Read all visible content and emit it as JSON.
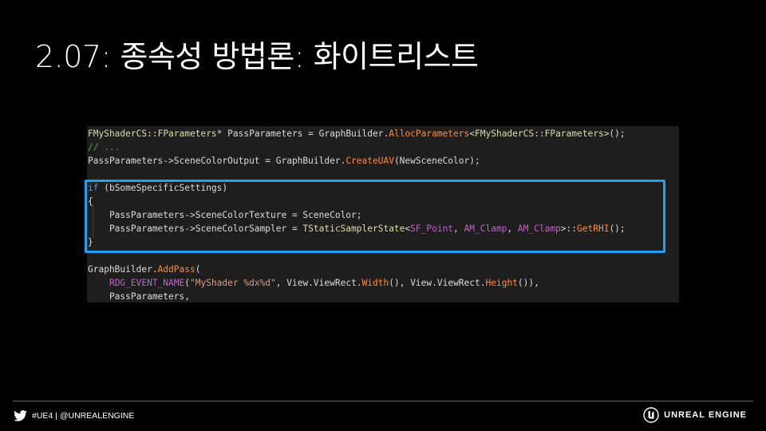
{
  "slide": {
    "title": "2.07: 종속성 방법론: 화이트리스트"
  },
  "code": {
    "line1": {
      "t1": "FMyShaderCS",
      "t2": "::",
      "t3": "FParameters",
      "t4": "* PassParameters = GraphBuilder.",
      "t5": "AllocParameters",
      "t6": "<",
      "t7": "FMyShaderCS",
      "t8": "::",
      "t9": "FParameters",
      "t10": ">();"
    },
    "line2": {
      "t1": "// ..."
    },
    "line3": {
      "t1": "PassParameters->SceneColorOutput = GraphBuilder.",
      "t2": "CreateUAV",
      "t3": "(NewSceneColor);"
    },
    "line4": {
      "t1": "if",
      "t2": " (bSomeSpecificSettings)"
    },
    "line5": {
      "t1": "{"
    },
    "line6": {
      "t1": "    PassParameters->SceneColorTexture = SceneColor;"
    },
    "line7": {
      "t1": "    PassParameters->SceneColorSampler = ",
      "t2": "TStaticSamplerState",
      "t3": "<",
      "t4": "SF_Point",
      "t5": ", ",
      "t6": "AM_Clamp",
      "t7": ", ",
      "t8": "AM_Clamp",
      "t9": ">::",
      "t10": "GetRHI",
      "t11": "();"
    },
    "line8": {
      "t1": "}"
    },
    "line9": {
      "t1": "GraphBuilder.",
      "t2": "AddPass",
      "t3": "("
    },
    "line10": {
      "t1": "    ",
      "t2": "RDG_EVENT_NAME",
      "t3": "(",
      "t4": "\"MyShader %dx%d\"",
      "t5": ", View.ViewRect.",
      "t6": "Width",
      "t7": "(), View.ViewRect.",
      "t8": "Height",
      "t9": "()),"
    },
    "line11": {
      "t1": "    PassParameters,"
    }
  },
  "footer": {
    "social_handle": "#UE4 | @UNREALENGINE",
    "brand": "UNREAL ENGINE",
    "icons": {
      "left": "twitter-icon",
      "right": "unreal-engine-logo-icon"
    }
  },
  "colors": {
    "background": "#000000",
    "code_background": "#1e1e1e",
    "highlight_border": "#1ea1f2",
    "type": "#dcdcaa",
    "function": "#ff8c3a",
    "comment": "#57a64a",
    "keyword": "#569cd6",
    "string": "#d69d85",
    "macro": "#bd63c5"
  }
}
